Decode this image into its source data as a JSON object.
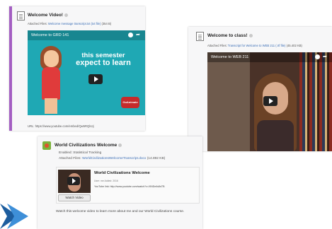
{
  "card_welcome_video": {
    "title": "Welcome Video!",
    "attached_label": "Attached Files:",
    "attached_file": "Welcome message transcript.txt (txt file)",
    "attached_size": "(354 B)",
    "video_title": "Welcome to GRD 141",
    "overlay_line1": "this semester",
    "overlay_line2": "expect to learn",
    "badge_text": "GoAnimate",
    "url_line": "URL: https://www.youtube.com/embed/Qw5RQl4Jj"
  },
  "card_welcome_class": {
    "title": "Welcome to class!",
    "attached_label": "Attached Files:",
    "attached_file": "Transcript for Welcome to WEB 211 (.rtf file)",
    "attached_size": "(45.402 KB)",
    "video_title": "Welcome to WEB 211"
  },
  "card_world_civ": {
    "title": "World Civilizations Welcome",
    "enabled_label": "Enabled:",
    "enabled_value": "Statistical Tracking",
    "attached_label": "Attached Files:",
    "attached_file": "WorldCivilizationsWelcomeTranscript.docx",
    "attached_size": "(14.892 KB)",
    "inner_title": "World Civilizations Welcome",
    "inner_meta": "User: me   Added: 2016",
    "inner_link": "YouTube link: http://www.youtube.com/watch?v=XlNDe4s5sTB",
    "watch_label": "Watch Video",
    "description": "Watch this welcome video to learn more about me and our World Civilizations course."
  },
  "colors": {
    "accent_bar": "#a35ec2",
    "link": "#3a6db5",
    "video_teal": "#1fa8b4",
    "arrow": "#2a7fc9"
  }
}
